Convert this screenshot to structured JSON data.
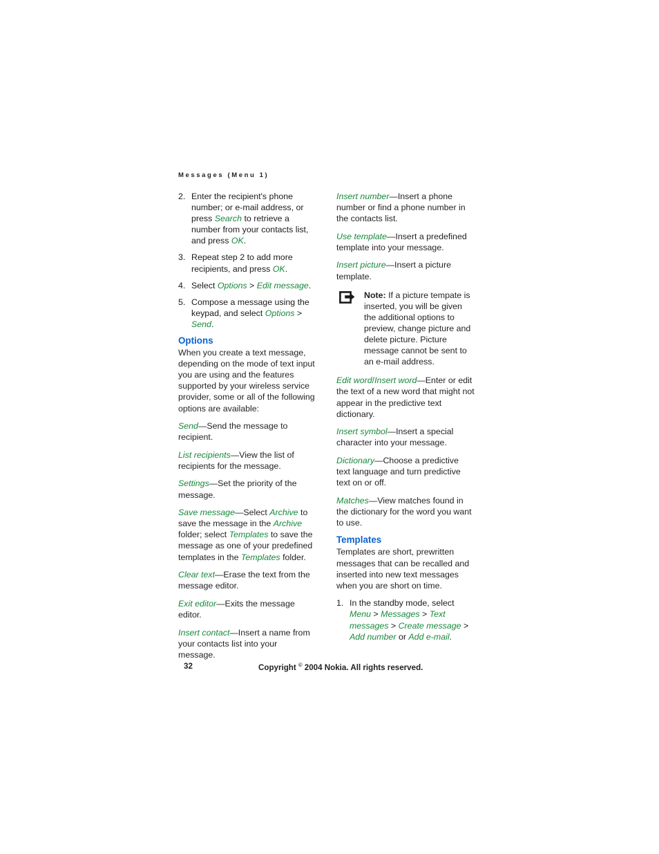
{
  "document": {
    "running_head": "Messages (Menu 1)",
    "page_number": "32",
    "copyright": "Copyright",
    "copyright_symbol": "©",
    "copyright_rest": "2004 Nokia. All rights reserved."
  },
  "left_column": {
    "steps": [
      {
        "number": "2.",
        "parts": [
          {
            "t": "Enter the recipient's phone number; or e-mail address, or press ",
            "s": "plain"
          },
          {
            "t": "Search",
            "s": "green"
          },
          {
            "t": " to retrieve a number from your contacts list, and press ",
            "s": "plain"
          },
          {
            "t": "OK",
            "s": "green"
          },
          {
            "t": ".",
            "s": "plain"
          }
        ]
      },
      {
        "number": "3.",
        "parts": [
          {
            "t": "Repeat step 2 to add more recipients, and press ",
            "s": "plain"
          },
          {
            "t": "OK",
            "s": "green"
          },
          {
            "t": ".",
            "s": "plain"
          }
        ]
      },
      {
        "number": "4.",
        "parts": [
          {
            "t": "Select ",
            "s": "plain"
          },
          {
            "t": "Options",
            "s": "green"
          },
          {
            "t": " > ",
            "s": "plain"
          },
          {
            "t": "Edit message",
            "s": "green"
          },
          {
            "t": ".",
            "s": "plain"
          }
        ]
      },
      {
        "number": "5.",
        "parts": [
          {
            "t": "Compose a message using the keypad, and select ",
            "s": "plain"
          },
          {
            "t": "Options",
            "s": "green"
          },
          {
            "t": " > ",
            "s": "plain"
          },
          {
            "t": "Send",
            "s": "green"
          },
          {
            "t": ".",
            "s": "plain"
          }
        ]
      }
    ],
    "options_heading": "Options",
    "options_intro": "When you create a text message, depending on the mode of text input you are using and the features supported by your wireless service provider, some or all of the following options are available:",
    "option_entries": [
      {
        "parts": [
          {
            "t": "Send",
            "s": "green"
          },
          {
            "t": "—Send the message to recipient.",
            "s": "plain"
          }
        ]
      },
      {
        "parts": [
          {
            "t": "List recipients",
            "s": "green"
          },
          {
            "t": "—View the list of recipients for the message.",
            "s": "plain"
          }
        ]
      },
      {
        "parts": [
          {
            "t": "Settings",
            "s": "green"
          },
          {
            "t": "—Set the priority of the message.",
            "s": "plain"
          }
        ]
      },
      {
        "parts": [
          {
            "t": "Save message",
            "s": "green"
          },
          {
            "t": "—Select ",
            "s": "plain"
          },
          {
            "t": "Archive",
            "s": "green"
          },
          {
            "t": " to save the message in the ",
            "s": "plain"
          },
          {
            "t": "Archive",
            "s": "green"
          },
          {
            "t": " folder; select ",
            "s": "plain"
          },
          {
            "t": "Templates",
            "s": "green"
          },
          {
            "t": " to save the message as one of your predefined templates in the ",
            "s": "plain"
          },
          {
            "t": "Templates",
            "s": "green"
          },
          {
            "t": " folder.",
            "s": "plain"
          }
        ]
      },
      {
        "parts": [
          {
            "t": "Clear text",
            "s": "green"
          },
          {
            "t": "—Erase the text from the message editor.",
            "s": "plain"
          }
        ]
      },
      {
        "parts": [
          {
            "t": "Exit editor",
            "s": "green"
          },
          {
            "t": "—Exits the message editor.",
            "s": "plain"
          }
        ]
      },
      {
        "parts": [
          {
            "t": "Insert contact",
            "s": "green"
          },
          {
            "t": "—Insert a name from your contacts list into your message.",
            "s": "plain"
          }
        ]
      }
    ]
  },
  "right_column": {
    "entries_top": [
      {
        "parts": [
          {
            "t": "Insert number",
            "s": "green"
          },
          {
            "t": "—Insert a phone number or find a phone number in the contacts list.",
            "s": "plain"
          }
        ]
      },
      {
        "parts": [
          {
            "t": "Use template",
            "s": "green"
          },
          {
            "t": "—Insert a predefined template into your message.",
            "s": "plain"
          }
        ]
      },
      {
        "parts": [
          {
            "t": "Insert picture",
            "s": "green"
          },
          {
            "t": "—Insert a picture template.",
            "s": "plain"
          }
        ]
      }
    ],
    "note": {
      "icon": "note-arrow-icon",
      "label": "Note:",
      "text": " If a picture tempate is inserted, you will be given the additional options to preview, change picture and delete picture. Picture message cannot be sent to an e-mail address."
    },
    "entries_bottom": [
      {
        "parts": [
          {
            "t": "Edit word",
            "s": "green"
          },
          {
            "t": "/",
            "s": "green-roman"
          },
          {
            "t": "Insert word",
            "s": "green"
          },
          {
            "t": "—Enter or edit the text of a new word that might not appear in the predictive text dictionary.",
            "s": "plain"
          }
        ]
      },
      {
        "parts": [
          {
            "t": "Insert symbol",
            "s": "green"
          },
          {
            "t": "—Insert a special character into your message.",
            "s": "plain"
          }
        ]
      },
      {
        "parts": [
          {
            "t": "Dictionary",
            "s": "green"
          },
          {
            "t": "—Choose a predictive text language and turn predictive text on or off.",
            "s": "plain"
          }
        ]
      },
      {
        "parts": [
          {
            "t": "Matches",
            "s": "green"
          },
          {
            "t": "—View matches found in the dictionary for the word you want to use.",
            "s": "plain"
          }
        ]
      }
    ],
    "templates_heading": "Templates",
    "templates_intro": "Templates are short, prewritten messages that can be recalled and inserted into new text messages when you are short on time.",
    "templates_steps": [
      {
        "number": "1.",
        "parts": [
          {
            "t": "In the standby mode, select ",
            "s": "plain"
          },
          {
            "t": "Menu",
            "s": "green"
          },
          {
            "t": " > ",
            "s": "plain"
          },
          {
            "t": "Messages",
            "s": "green"
          },
          {
            "t": " > ",
            "s": "plain"
          },
          {
            "t": "Text messages",
            "s": "green"
          },
          {
            "t": " > ",
            "s": "plain"
          },
          {
            "t": "Create message",
            "s": "green"
          },
          {
            "t": " > ",
            "s": "plain"
          },
          {
            "t": "Add number",
            "s": "green"
          },
          {
            "t": " or ",
            "s": "plain"
          },
          {
            "t": "Add e-mail",
            "s": "green"
          },
          {
            "t": ".",
            "s": "plain"
          }
        ]
      }
    ]
  },
  "colors": {
    "heading_blue": "#0a62d0",
    "term_green": "#17883b",
    "body_black": "#231f20"
  }
}
